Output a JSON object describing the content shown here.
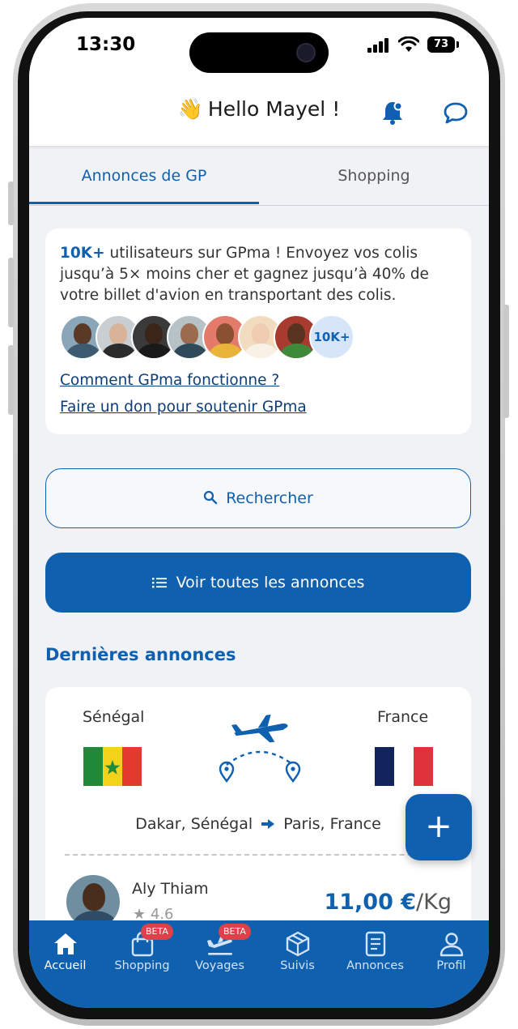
{
  "status_bar": {
    "time": "13:30",
    "battery": "73"
  },
  "header": {
    "greeting_emoji": "👋",
    "greeting": "Hello Mayel !"
  },
  "tabs": [
    {
      "label": "Annonces de GP",
      "active": true
    },
    {
      "label": "Shopping",
      "active": false
    }
  ],
  "promo": {
    "highlight": "10K+",
    "text": " utilisateurs sur GPma ! Envoyez vos colis jusqu’à 5× moins cher et gagnez jusqu’à 40% de votre billet d'avion en transportant des colis.",
    "avatar_count_label": "10K+",
    "link_how": "Comment GPma fonctionne ?",
    "link_donate": "Faire un don pour soutenir GPma"
  },
  "actions": {
    "search_label": "Rechercher",
    "view_all_label": "Voir toutes les annonces"
  },
  "latest": {
    "title": "Dernières annonces",
    "listing": {
      "from_country": "Sénégal",
      "to_country": "France",
      "from_city": "Dakar, Sénégal",
      "to_city": "Paris, France",
      "user_name": "Aly Thiam",
      "rating": "★ 4.6",
      "price": "11,00 €",
      "price_unit": "/Kg"
    }
  },
  "fab": {
    "label": "+"
  },
  "bottom_nav": {
    "items": [
      {
        "label": "Accueil",
        "icon": "home-icon",
        "active": true
      },
      {
        "label": "Shopping",
        "icon": "shopping-bag-icon",
        "badge": "BETA"
      },
      {
        "label": "Voyages",
        "icon": "plane-departure-icon",
        "badge": "BETA"
      },
      {
        "label": "Suivis",
        "icon": "package-icon"
      },
      {
        "label": "Annonces",
        "icon": "document-icon"
      },
      {
        "label": "Profil",
        "icon": "user-icon"
      }
    ]
  },
  "colors": {
    "primary": "#1060b0",
    "badge": "#e0404a",
    "background": "#f0f2f5"
  }
}
